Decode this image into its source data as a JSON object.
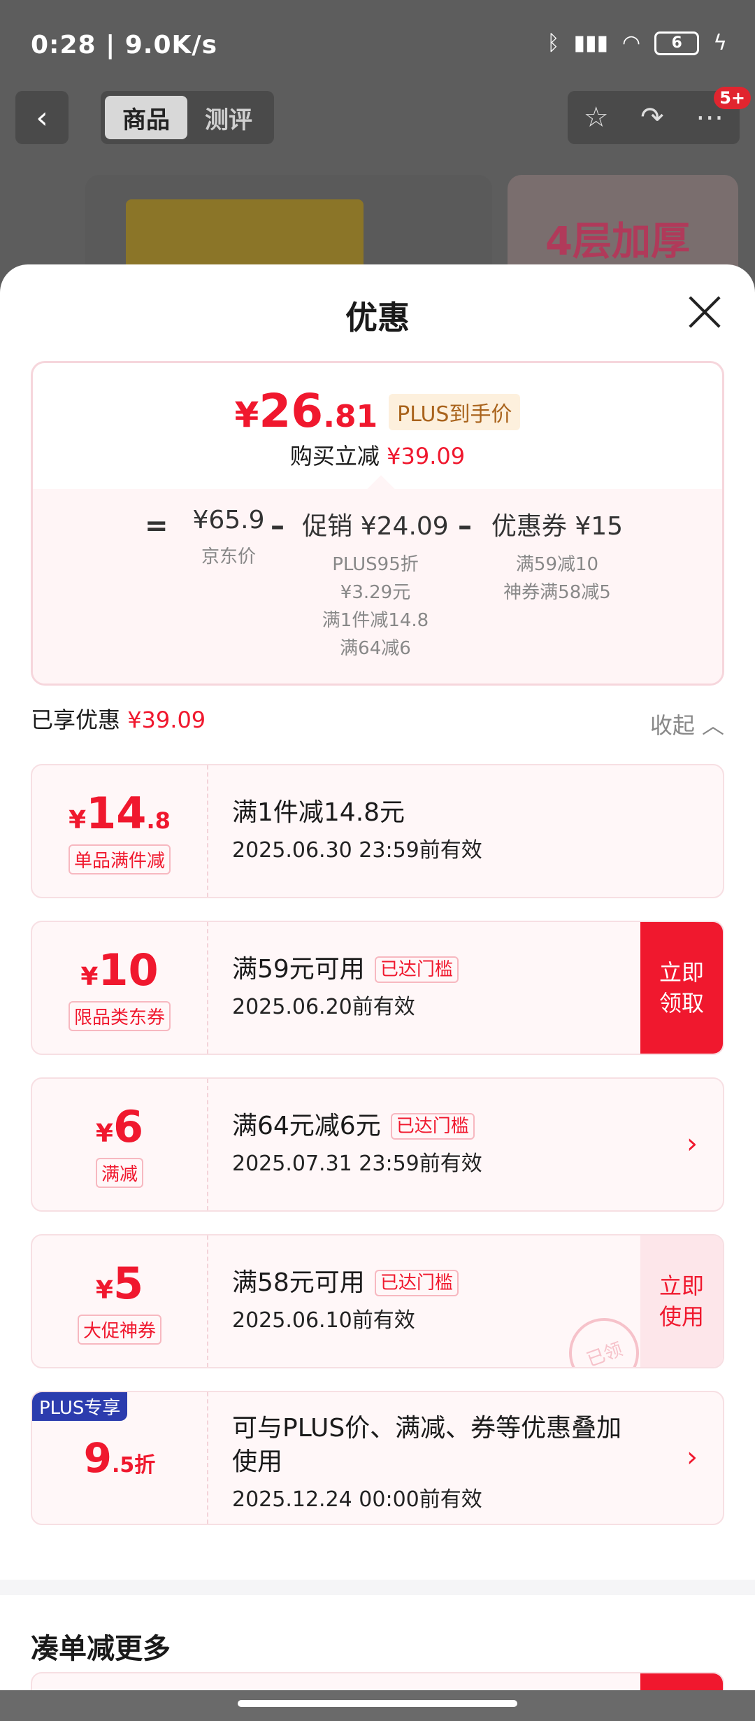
{
  "status_bar": {
    "time_speed": "0:28 | 9.0K/s",
    "battery": "6"
  },
  "nav": {
    "tab_goods": "商品",
    "tab_reviews": "测评",
    "badge": "5+"
  },
  "background_product": {
    "promo_text": "4层加厚"
  },
  "sheet": {
    "title": "优惠",
    "price": {
      "yen": "¥",
      "integer": "26",
      "decimal": ".81",
      "tag": "PLUS到手价"
    },
    "saved": {
      "label": "购买立减",
      "amount": "¥39.09"
    },
    "calc": {
      "eq": "=",
      "minus": "–",
      "jd_price": "¥65.9",
      "jd_price_label": "京东价",
      "promo": "促销 ¥24.09",
      "promo_details": [
        "PLUS95折",
        "¥3.29元",
        "满1件减14.8",
        "满64减6"
      ],
      "coupon": "优惠券 ¥15",
      "coupon_details": [
        "满59减10",
        "神券满58减5"
      ]
    },
    "enjoyed": {
      "label": "已享优惠",
      "amount": "¥39.09"
    },
    "collapse_label": "收起 ︿"
  },
  "coupons": [
    {
      "symbol": "¥",
      "big": "14",
      "small": ".8",
      "type": "单品满件减",
      "title": "满1件减14.8元",
      "date": "2025.06.30 23:59前有效"
    },
    {
      "symbol": "¥",
      "big": "10",
      "small": "",
      "type": "限品类东券",
      "title": "满59元可用",
      "reached": "已达门槛",
      "date": "2025.06.20前有效",
      "action": "立即领取"
    },
    {
      "symbol": "¥",
      "big": "6",
      "small": "",
      "type": "满减",
      "title": "满64元减6元",
      "reached": "已达门槛",
      "date": "2025.07.31 23:59前有效"
    },
    {
      "symbol": "¥",
      "big": "5",
      "small": "",
      "type": "大促神券",
      "title": "满58元可用",
      "reached": "已达门槛",
      "date": "2025.06.10前有效",
      "action": "立即使用",
      "stamp": "已领"
    },
    {
      "flag": "PLUS专享",
      "big": "9",
      "small": ".5折",
      "title": "可与PLUS价、满减、券等优惠叠加使用",
      "date": "2025.12.24 00:00前有效"
    }
  ],
  "more_section": {
    "title": "凑单减更多"
  },
  "colors": {
    "accent": "#f0182e",
    "plus_blue": "#2c3cae"
  }
}
